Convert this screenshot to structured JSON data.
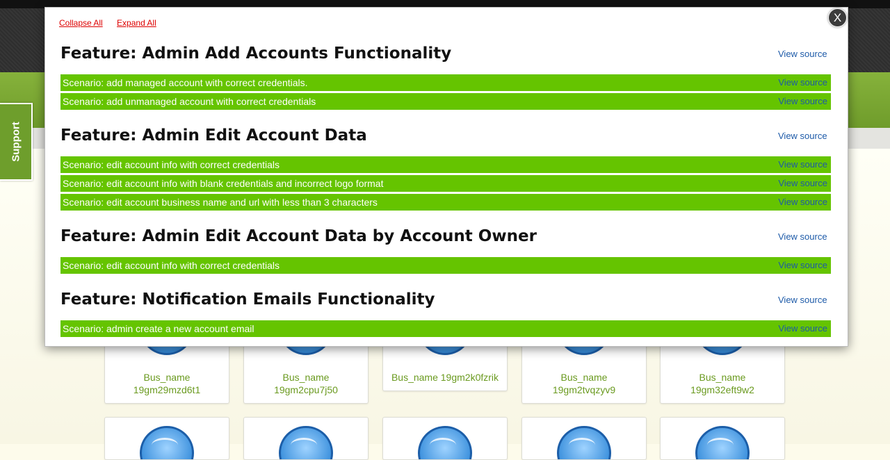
{
  "support": {
    "label": "Support"
  },
  "modal": {
    "collapse_all": "Collapse All",
    "expand_all": "Expand All",
    "close_label": "X"
  },
  "features": [
    {
      "title": "Feature: Admin Add Accounts Functionality",
      "view_source": "View source",
      "scenarios": [
        {
          "text": "Scenario: add managed account with correct credentials.",
          "view_source": "View source"
        },
        {
          "text": "Scenario: add unmanaged account with correct credentials",
          "view_source": "View source"
        }
      ]
    },
    {
      "title": "Feature: Admin Edit Account Data",
      "view_source": "View source",
      "scenarios": [
        {
          "text": "Scenario: edit account info with correct credentials",
          "view_source": "View source"
        },
        {
          "text": "Scenario: edit account info with blank credentials and incorrect logo format",
          "view_source": "View source"
        },
        {
          "text": "Scenario: edit account business name and url with less than 3 characters",
          "view_source": "View source"
        }
      ]
    },
    {
      "title": "Feature: Admin Edit Account Data by Account Owner",
      "view_source": "View source",
      "scenarios": [
        {
          "text": "Scenario: edit account info with correct credentials",
          "view_source": "View source"
        }
      ]
    },
    {
      "title": "Feature: Notification Emails Functionality",
      "view_source": "View source",
      "scenarios": [
        {
          "text": "Scenario: admin create a new account email",
          "view_source": "View source"
        }
      ]
    }
  ],
  "tiles": [
    {
      "line1": "Bus_name",
      "line2": "19gm29mzd6t1"
    },
    {
      "line1": "Bus_name",
      "line2": "19gm2cpu7j50"
    },
    {
      "line1": "Bus_name 19gm2k0fzrik",
      "line2": ""
    },
    {
      "line1": "Bus_name",
      "line2": "19gm2tvqzyv9"
    },
    {
      "line1": "Bus_name",
      "line2": "19gm32eft9w2"
    }
  ],
  "colors": {
    "scenario_bg": "#65c400",
    "link_red": "#dd0000",
    "view_source_blue": "#1d5aa8",
    "header_green": "#6f9c2b"
  }
}
